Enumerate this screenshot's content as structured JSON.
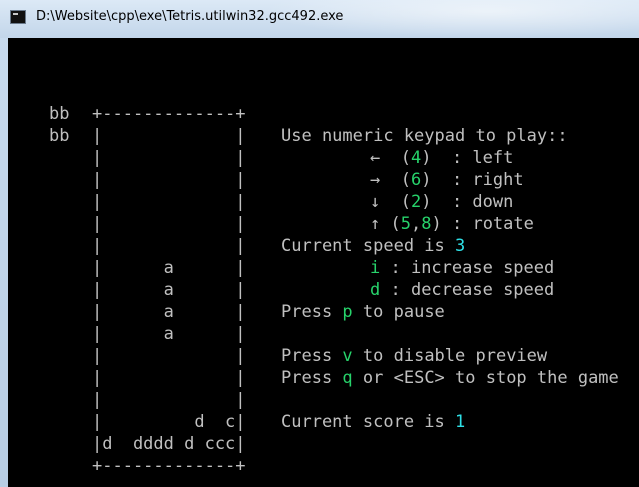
{
  "window": {
    "title": "D:\\Website\\cpp\\exe\\Tetris.utilwin32.gcc492.exe",
    "colors": {
      "console_bg": "#000000",
      "text": "#c0c0c0",
      "green": "#27d36b",
      "cyan": "#2ee0e6"
    }
  },
  "icons": {
    "app": "console-app-icon"
  },
  "board": {
    "next_preview": [
      "bb",
      "bb"
    ],
    "top_border": "+-------------+",
    "bottom_border": "+-------------+",
    "rows": [
      "|             |",
      "|             |",
      "|             |",
      "|             |",
      "|             |",
      "|             |",
      "|      a      |",
      "|      a      |",
      "|      a      |",
      "|      a      |",
      "|             |",
      "|             |",
      "|             |",
      "|         d  c|",
      "|d  dddd d ccc|"
    ]
  },
  "instructions": {
    "heading": "Use numeric keypad to play::",
    "controls": [
      {
        "arrow": "←",
        "key": "4",
        "sep": "  : ",
        "action": "left"
      },
      {
        "arrow": "→",
        "key": "6",
        "sep": "  : ",
        "action": "right"
      },
      {
        "arrow": "↓",
        "key": "2",
        "sep": "  : ",
        "action": "down"
      }
    ],
    "rotate": {
      "arrow": "↑",
      "key_a": "5",
      "comma": ",",
      "key_b": "8",
      "sep": " : ",
      "action": "rotate"
    },
    "speed": {
      "label": "Current speed is ",
      "value": "3",
      "increase_key": "i",
      "increase_text": " : increase speed",
      "decrease_key": "d",
      "decrease_text": " : decrease speed"
    },
    "pause": {
      "prefix": "Press ",
      "key": "p",
      "suffix": " to pause"
    },
    "preview": {
      "prefix": "Press ",
      "key": "v",
      "suffix": " to disable preview"
    },
    "stop": {
      "prefix": "Press ",
      "key": "q",
      "suffix": " or <ESC> to stop the game"
    },
    "score": {
      "label": "Current score is ",
      "value": "1"
    }
  }
}
